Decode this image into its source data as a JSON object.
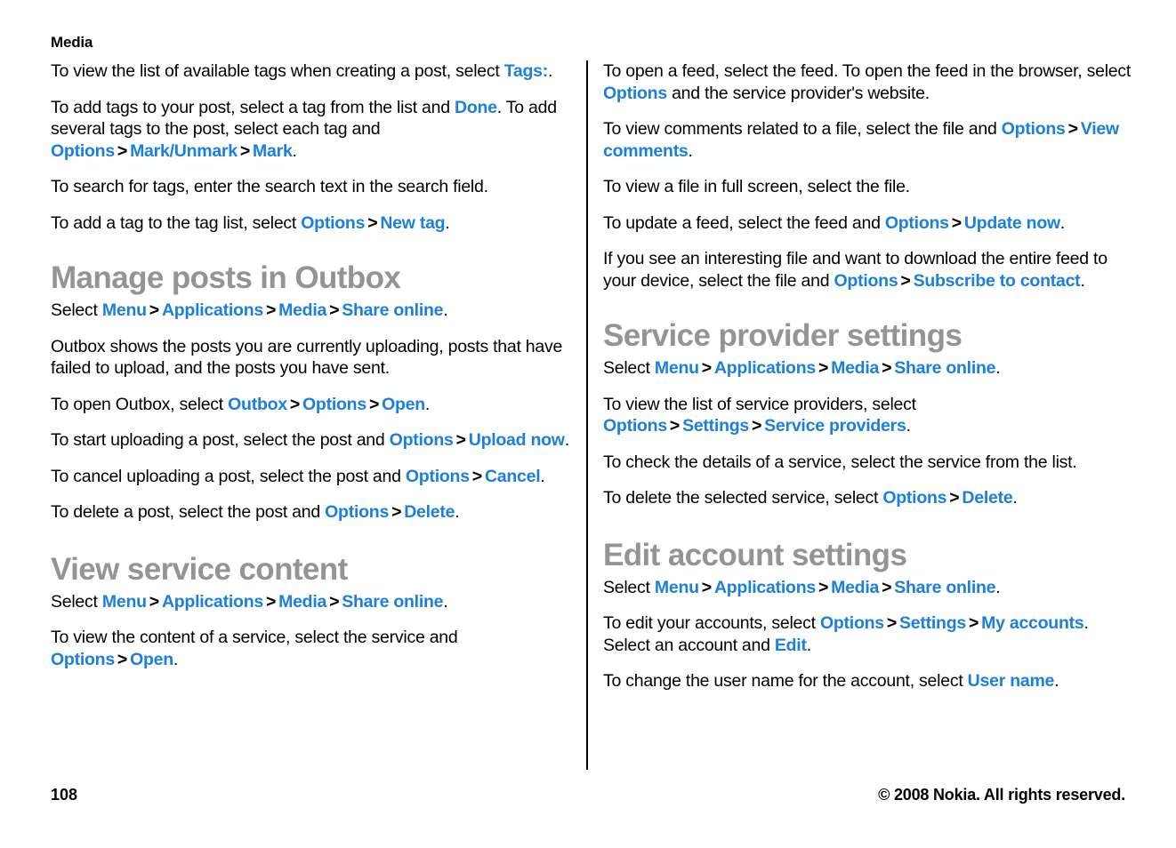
{
  "document": {
    "running_head": "Media",
    "page_number": "108",
    "copyright": "© 2008 Nokia. All rights reserved.",
    "accent_color": "#1a7fe0",
    "heading_color": "#949494",
    "body_color": "#000000"
  },
  "left_column": {
    "paragraphs": [
      {
        "id": "p1",
        "runs": [
          {
            "t": "To view the list of available tags when creating a post, select ",
            "s": "plain"
          },
          {
            "t": "Tags:",
            "s": "kw"
          },
          {
            "t": ".",
            "s": "plain"
          }
        ]
      },
      {
        "id": "p2",
        "runs": [
          {
            "t": "To add tags to your post, select a tag from the list and ",
            "s": "plain"
          },
          {
            "t": "Done",
            "s": "kw"
          },
          {
            "t": ". To add several tags to the post, select each tag and ",
            "s": "plain"
          },
          {
            "t": "Options",
            "s": "kw"
          },
          {
            "t": ">",
            "s": "sep"
          },
          {
            "t": "Mark/Unmark",
            "s": "kw"
          },
          {
            "t": ">",
            "s": "sep"
          },
          {
            "t": "Mark",
            "s": "kw"
          },
          {
            "t": ".",
            "s": "plain"
          }
        ]
      },
      {
        "id": "p3",
        "runs": [
          {
            "t": "To search for tags, enter the search text in the search field.",
            "s": "plain"
          }
        ]
      },
      {
        "id": "p4",
        "runs": [
          {
            "t": "To add a tag to the tag list, select ",
            "s": "plain"
          },
          {
            "t": "Options",
            "s": "kw"
          },
          {
            "t": ">",
            "s": "sep"
          },
          {
            "t": "New tag",
            "s": "kw"
          },
          {
            "t": ".",
            "s": "plain"
          }
        ]
      }
    ],
    "sections": [
      {
        "id": "manage-posts-in-outbox",
        "heading": "Manage posts in Outbox",
        "paragraphs": [
          {
            "id": "mp1",
            "runs": [
              {
                "t": "Select ",
                "s": "plain"
              },
              {
                "t": "Menu",
                "s": "kw"
              },
              {
                "t": ">",
                "s": "sep"
              },
              {
                "t": "Applications",
                "s": "kw"
              },
              {
                "t": ">",
                "s": "sep"
              },
              {
                "t": "Media",
                "s": "kw"
              },
              {
                "t": ">",
                "s": "sep"
              },
              {
                "t": "Share online",
                "s": "kw"
              },
              {
                "t": ".",
                "s": "plain"
              }
            ]
          },
          {
            "id": "mp2",
            "runs": [
              {
                "t": "Outbox shows the posts you are currently uploading, posts that have failed to upload, and the posts you have sent.",
                "s": "plain"
              }
            ]
          },
          {
            "id": "mp3",
            "runs": [
              {
                "t": "To open Outbox, select ",
                "s": "plain"
              },
              {
                "t": "Outbox",
                "s": "kw"
              },
              {
                "t": ">",
                "s": "sep"
              },
              {
                "t": "Options",
                "s": "kw"
              },
              {
                "t": ">",
                "s": "sep"
              },
              {
                "t": "Open",
                "s": "kw"
              },
              {
                "t": ".",
                "s": "plain"
              }
            ]
          },
          {
            "id": "mp4",
            "runs": [
              {
                "t": "To start uploading a post, select the post and ",
                "s": "plain"
              },
              {
                "t": "Options",
                "s": "kw"
              },
              {
                "t": ">",
                "s": "sep"
              },
              {
                "t": "Upload now",
                "s": "kw"
              },
              {
                "t": ".",
                "s": "plain"
              }
            ]
          },
          {
            "id": "mp5",
            "runs": [
              {
                "t": "To cancel uploading a post, select the post and ",
                "s": "plain"
              },
              {
                "t": "Options",
                "s": "kw"
              },
              {
                "t": ">",
                "s": "sep"
              },
              {
                "t": "Cancel",
                "s": "kw"
              },
              {
                "t": ".",
                "s": "plain"
              }
            ]
          },
          {
            "id": "mp6",
            "runs": [
              {
                "t": "To delete a post, select the post and ",
                "s": "plain"
              },
              {
                "t": "Options",
                "s": "kw"
              },
              {
                "t": ">",
                "s": "sep"
              },
              {
                "t": "Delete",
                "s": "kw"
              },
              {
                "t": ".",
                "s": "plain"
              }
            ]
          }
        ]
      },
      {
        "id": "view-service-content",
        "heading": "View service content",
        "paragraphs": [
          {
            "id": "vs1",
            "runs": [
              {
                "t": "Select ",
                "s": "plain"
              },
              {
                "t": "Menu",
                "s": "kw"
              },
              {
                "t": ">",
                "s": "sep"
              },
              {
                "t": "Applications",
                "s": "kw"
              },
              {
                "t": ">",
                "s": "sep"
              },
              {
                "t": "Media",
                "s": "kw"
              },
              {
                "t": ">",
                "s": "sep"
              },
              {
                "t": "Share online",
                "s": "kw"
              },
              {
                "t": ".",
                "s": "plain"
              }
            ]
          },
          {
            "id": "vs2",
            "runs": [
              {
                "t": "To view the content of a service, select the service and ",
                "s": "plain"
              },
              {
                "t": "Options",
                "s": "kw"
              },
              {
                "t": ">",
                "s": "sep"
              },
              {
                "t": "Open",
                "s": "kw"
              },
              {
                "t": ".",
                "s": "plain"
              }
            ]
          }
        ]
      }
    ]
  },
  "right_column": {
    "paragraphs": [
      {
        "id": "r1",
        "runs": [
          {
            "t": "To open a feed, select the feed. To open the feed in the browser, select ",
            "s": "plain"
          },
          {
            "t": "Options",
            "s": "kw"
          },
          {
            "t": " and the service provider's website.",
            "s": "plain"
          }
        ]
      },
      {
        "id": "r2",
        "runs": [
          {
            "t": "To view comments related to a file, select the file and ",
            "s": "plain"
          },
          {
            "t": "Options",
            "s": "kw"
          },
          {
            "t": ">",
            "s": "sep"
          },
          {
            "t": "View comments",
            "s": "kw"
          },
          {
            "t": ".",
            "s": "plain"
          }
        ]
      },
      {
        "id": "r3",
        "runs": [
          {
            "t": "To view a file in full screen, select the file.",
            "s": "plain"
          }
        ]
      },
      {
        "id": "r4",
        "runs": [
          {
            "t": "To update a feed, select the feed and ",
            "s": "plain"
          },
          {
            "t": "Options",
            "s": "kw"
          },
          {
            "t": ">",
            "s": "sep"
          },
          {
            "t": "Update now",
            "s": "kw"
          },
          {
            "t": ".",
            "s": "plain"
          }
        ]
      },
      {
        "id": "r5",
        "runs": [
          {
            "t": "If you see an interesting file and want to download the entire feed to your device, select the file and ",
            "s": "plain"
          },
          {
            "t": "Options",
            "s": "kw"
          },
          {
            "t": ">",
            "s": "sep"
          },
          {
            "t": "Subscribe to contact",
            "s": "kw"
          },
          {
            "t": ".",
            "s": "plain"
          }
        ]
      }
    ],
    "sections": [
      {
        "id": "service-provider-settings",
        "heading": "Service provider settings",
        "paragraphs": [
          {
            "id": "sp1",
            "runs": [
              {
                "t": "Select ",
                "s": "plain"
              },
              {
                "t": "Menu",
                "s": "kw"
              },
              {
                "t": ">",
                "s": "sep"
              },
              {
                "t": "Applications",
                "s": "kw"
              },
              {
                "t": ">",
                "s": "sep"
              },
              {
                "t": "Media",
                "s": "kw"
              },
              {
                "t": ">",
                "s": "sep"
              },
              {
                "t": "Share online",
                "s": "kw"
              },
              {
                "t": ".",
                "s": "plain"
              }
            ]
          },
          {
            "id": "sp2",
            "runs": [
              {
                "t": "To view the list of service providers, select ",
                "s": "plain"
              },
              {
                "t": "Options",
                "s": "kw"
              },
              {
                "t": ">",
                "s": "sep"
              },
              {
                "t": "Settings",
                "s": "kw"
              },
              {
                "t": ">",
                "s": "sep"
              },
              {
                "t": "Service providers",
                "s": "kw"
              },
              {
                "t": ".",
                "s": "plain"
              }
            ]
          },
          {
            "id": "sp3",
            "runs": [
              {
                "t": "To check the details of a service, select the service from the list.",
                "s": "plain"
              }
            ]
          },
          {
            "id": "sp4",
            "runs": [
              {
                "t": "To delete the selected service, select ",
                "s": "plain"
              },
              {
                "t": "Options",
                "s": "kw"
              },
              {
                "t": ">",
                "s": "sep"
              },
              {
                "t": "Delete",
                "s": "kw"
              },
              {
                "t": ".",
                "s": "plain"
              }
            ]
          }
        ]
      },
      {
        "id": "edit-account-settings",
        "heading": "Edit account settings",
        "paragraphs": [
          {
            "id": "ea1",
            "runs": [
              {
                "t": "Select ",
                "s": "plain"
              },
              {
                "t": "Menu",
                "s": "kw"
              },
              {
                "t": ">",
                "s": "sep"
              },
              {
                "t": "Applications",
                "s": "kw"
              },
              {
                "t": ">",
                "s": "sep"
              },
              {
                "t": "Media",
                "s": "kw"
              },
              {
                "t": ">",
                "s": "sep"
              },
              {
                "t": "Share online",
                "s": "kw"
              },
              {
                "t": ".",
                "s": "plain"
              }
            ]
          },
          {
            "id": "ea2",
            "runs": [
              {
                "t": "To edit your accounts, select ",
                "s": "plain"
              },
              {
                "t": "Options",
                "s": "kw"
              },
              {
                "t": ">",
                "s": "sep"
              },
              {
                "t": "Settings",
                "s": "kw"
              },
              {
                "t": ">",
                "s": "sep"
              },
              {
                "t": "My accounts",
                "s": "kw"
              },
              {
                "t": ". Select an account and ",
                "s": "plain"
              },
              {
                "t": "Edit",
                "s": "kw"
              },
              {
                "t": ".",
                "s": "plain"
              }
            ]
          },
          {
            "id": "ea3",
            "runs": [
              {
                "t": "To change the user name for the account, select ",
                "s": "plain"
              },
              {
                "t": "User name",
                "s": "kw"
              },
              {
                "t": ".",
                "s": "plain"
              }
            ]
          }
        ]
      }
    ]
  }
}
